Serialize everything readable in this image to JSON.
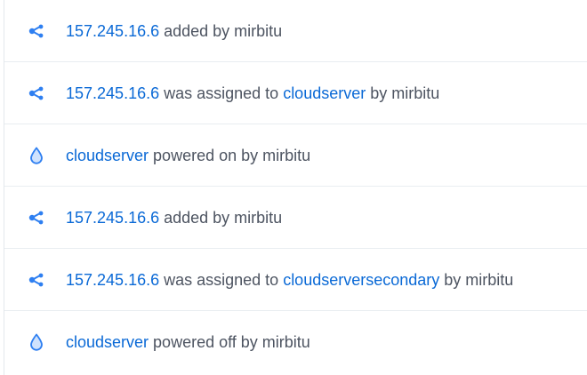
{
  "colors": {
    "link": "#0a69d6",
    "text": "#4d5461",
    "icon": "#2e7ff1"
  },
  "activity": [
    {
      "icon": "ip-share-icon",
      "link1": "157.245.16.6",
      "middle": " added by mirbitu",
      "link2": "",
      "tail": ""
    },
    {
      "icon": "ip-share-icon",
      "link1": "157.245.16.6",
      "middle": " was assigned to ",
      "link2": "cloudserver",
      "tail": " by mirbitu"
    },
    {
      "icon": "droplet-icon",
      "link1": "cloudserver",
      "middle": " powered on by mirbitu",
      "link2": "",
      "tail": ""
    },
    {
      "icon": "ip-share-icon",
      "link1": "157.245.16.6",
      "middle": " added by mirbitu",
      "link2": "",
      "tail": ""
    },
    {
      "icon": "ip-share-icon",
      "link1": "157.245.16.6",
      "middle": " was assigned to ",
      "link2": "cloudserversecondary",
      "tail": " by mirbitu"
    },
    {
      "icon": "droplet-icon",
      "link1": "cloudserver",
      "middle": " powered off by mirbitu",
      "link2": "",
      "tail": ""
    }
  ]
}
